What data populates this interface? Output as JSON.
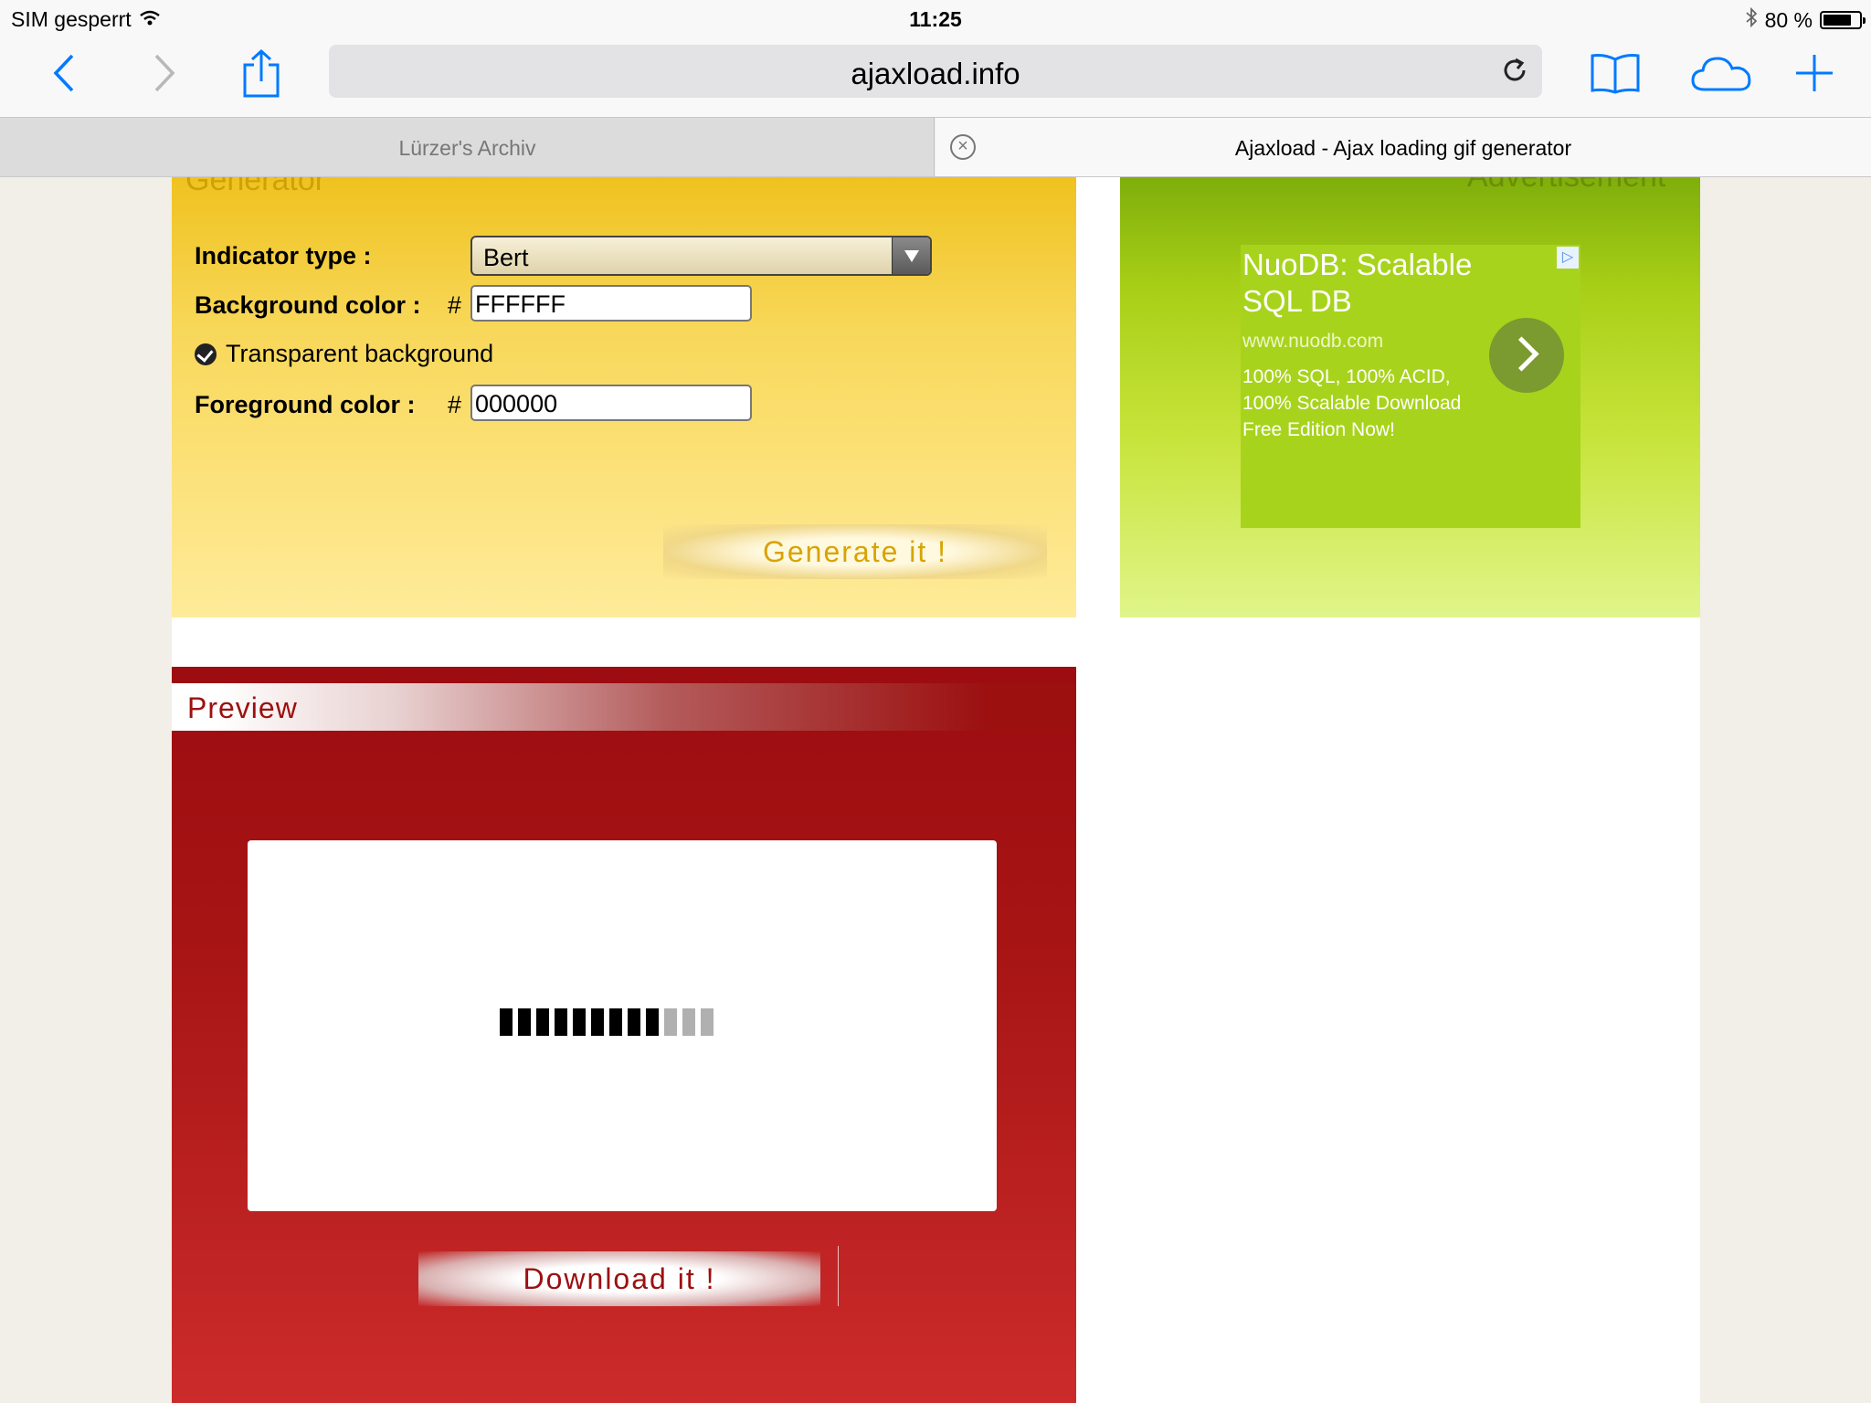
{
  "status_bar": {
    "carrier": "SIM gesperrt",
    "time": "11:25",
    "battery_text": "80 %",
    "battery_level": 0.8
  },
  "toolbar": {
    "url": "ajaxload.info"
  },
  "tabs": [
    {
      "title": "Lürzer's Archiv",
      "active": false
    },
    {
      "title": "Ajaxload - Ajax loading gif generator",
      "active": true
    }
  ],
  "generator": {
    "title": "Generator",
    "indicator_label": "Indicator type :",
    "indicator_value": "Bert",
    "bg_label": "Background color :",
    "hash": "#",
    "bg_value": "FFFFFF",
    "transparent_label": "Transparent background",
    "transparent_checked": true,
    "fg_label": "Foreground color :",
    "fg_value": "000000",
    "button": "Generate it !"
  },
  "ad": {
    "title": "Advertisement",
    "headline": "NuoDB: Scalable SQL DB",
    "url": "www.nuodb.com",
    "description": "100% SQL, 100% ACID, 100% Scalable Download Free Edition Now!",
    "adchoices_icon": "adchoices-icon"
  },
  "preview": {
    "title": "Preview",
    "loader": {
      "segments": 12,
      "filled": 9,
      "filled_color": "#000000",
      "empty_color": "#b0b0b0"
    },
    "button": "Download it !"
  },
  "colors": {
    "accent": "#007aff",
    "generator_panel": "#f8d85a",
    "ad_panel": "#a8cf17",
    "preview_panel": "#a81515"
  }
}
